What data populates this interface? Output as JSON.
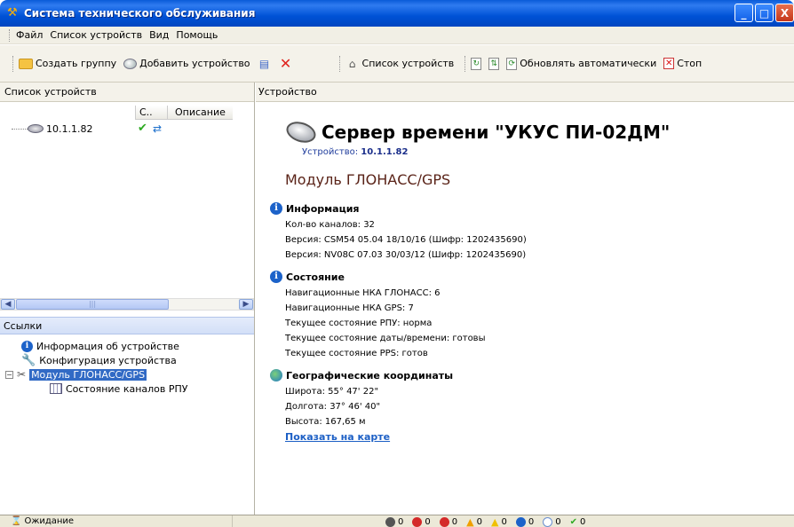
{
  "window": {
    "title": "Система технического обслуживания",
    "controls": [
      "_",
      "□",
      "X"
    ]
  },
  "menu": [
    "Файл",
    "Список устройств",
    "Вид",
    "Помощь"
  ],
  "toolbar": {
    "create_group": "Создать группу",
    "add_device": "Добавить устройство",
    "device_list": "Список устройств",
    "auto_update": "Обновлять автоматически",
    "stop": "Стоп"
  },
  "left_pane": {
    "header": "Список устройств",
    "columns": {
      "c": "С..",
      "description": "Описание"
    },
    "devices": [
      {
        "name": "10.1.1.82",
        "status": "ok"
      }
    ]
  },
  "links": {
    "header": "Ссылки",
    "items": [
      "Информация об устройстве",
      "Конфигурация устройства",
      "Модуль ГЛОНАСС/GPS",
      "Состояние каналов РПУ"
    ]
  },
  "right_pane": {
    "header": "Устройство",
    "device_name": "Сервер времени \"УКУС ПИ-02ДМ\"",
    "device_label": "Устройство:",
    "device_ip": "10.1.1.82",
    "module_title": "Модуль ГЛОНАСС/GPS",
    "sections": {
      "info": {
        "title": "Информация",
        "lines": [
          "Кол-во каналов: 32",
          "Версия: CSM54 05.04 18/10/16 (Шифр: 1202435690)",
          "Версия: NV08C 07.03 30/03/12 (Шифр: 1202435690)"
        ]
      },
      "state": {
        "title": "Состояние",
        "lines": [
          "Навигационные НКА ГЛОНАСС: 6",
          "Навигационные НКА GPS: 7",
          "Текущее состояние РПУ: норма",
          "Текущее состояние даты/времени: готовы",
          "Текущее состояние PPS: готов"
        ]
      },
      "geo": {
        "title": "Географические координаты",
        "lines": [
          "Широта: 55° 47' 22\"",
          "Долгота: 37° 46' 40\"",
          "Высота: 167,65 м"
        ],
        "map_link": "Показать на карте"
      }
    }
  },
  "statusbar": {
    "state": "Ожидание",
    "counters": [
      {
        "value": "0",
        "color": "#555555"
      },
      {
        "value": "0",
        "color": "#d42a2a"
      },
      {
        "value": "0",
        "color": "#d42a2a"
      },
      {
        "value": "0",
        "color": "#f0a000"
      },
      {
        "value": "0",
        "color": "#f0c000"
      },
      {
        "value": "0",
        "color": "#1c62c9"
      },
      {
        "value": "0",
        "color": "#6a8fd0"
      },
      {
        "value": "0",
        "color": "#2eaa22"
      }
    ]
  }
}
